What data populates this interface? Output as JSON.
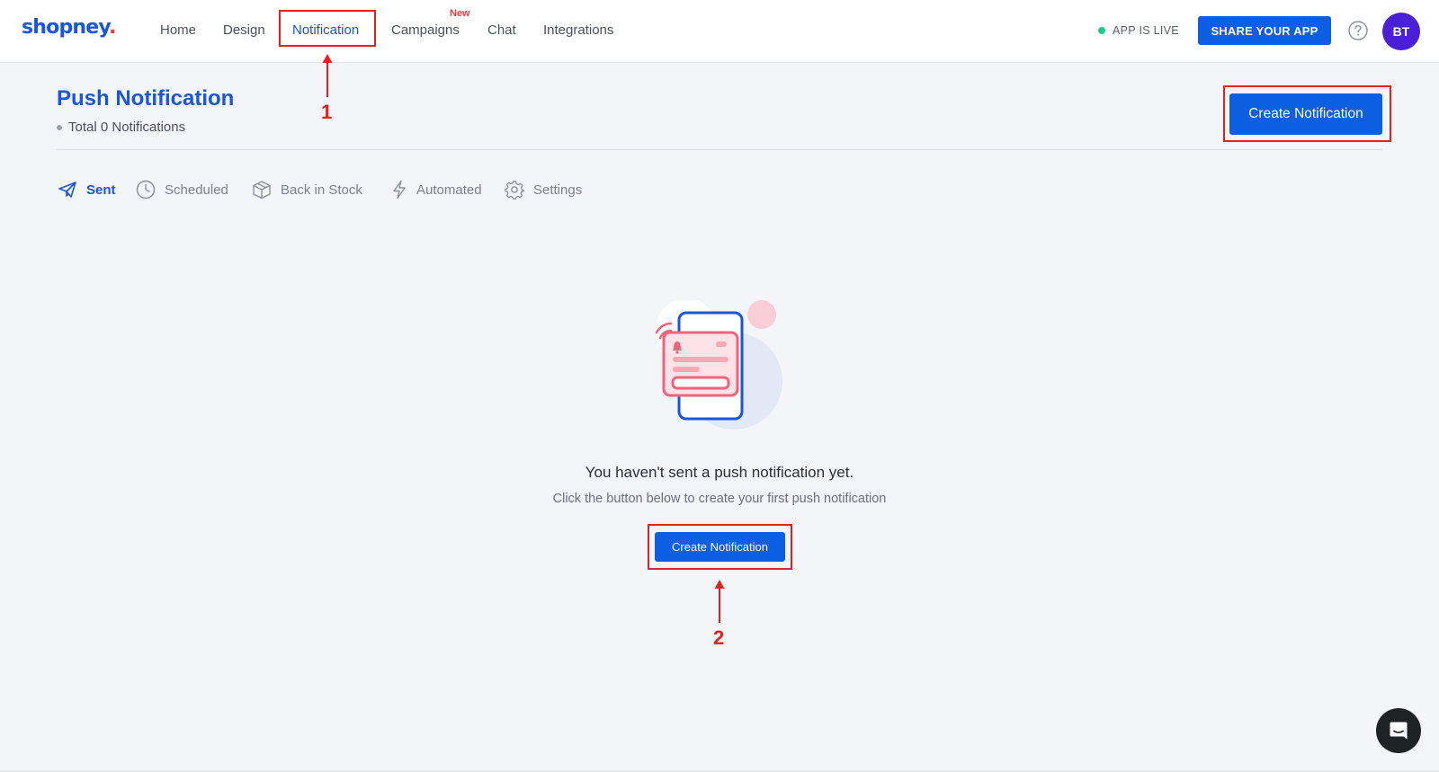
{
  "brand": {
    "name": "shopney",
    "dot": "."
  },
  "nav": {
    "items": [
      {
        "id": "home",
        "label": "Home"
      },
      {
        "id": "design",
        "label": "Design"
      },
      {
        "id": "notification",
        "label": "Notification"
      },
      {
        "id": "campaigns",
        "label": "Campaigns"
      },
      {
        "id": "chat",
        "label": "Chat"
      },
      {
        "id": "integrations",
        "label": "Integrations"
      }
    ],
    "active": "notification",
    "new_badge": "New"
  },
  "header_right": {
    "live_status": "APP IS LIVE",
    "share_button": "SHARE YOUR APP",
    "avatar_initials": "BT"
  },
  "page": {
    "title": "Push Notification",
    "total_text": "Total 0 Notifications",
    "create_button": "Create Notification"
  },
  "tabs": [
    {
      "id": "sent",
      "label": "Sent",
      "icon": "paper-plane-icon"
    },
    {
      "id": "scheduled",
      "label": "Scheduled",
      "icon": "clock-icon"
    },
    {
      "id": "back_in_stock",
      "label": "Back in Stock",
      "icon": "box-icon"
    },
    {
      "id": "automated",
      "label": "Automated",
      "icon": "lightning-icon"
    },
    {
      "id": "settings",
      "label": "Settings",
      "icon": "gear-icon"
    }
  ],
  "active_tab": "sent",
  "empty_state": {
    "title": "You haven't sent a push notification yet.",
    "subtitle": "Click the button below to create your first push notification",
    "button": "Create Notification"
  },
  "annotations": {
    "step1": "1",
    "step2": "2",
    "color": "#e5211f"
  },
  "colors": {
    "primary": "#0b5fe0",
    "title_blue": "#1a56db",
    "live_green": "#1ec98b",
    "avatar": "#4a1fd6",
    "accent_red": "#ef3b3b",
    "illustration_pink": "#f0637a"
  }
}
